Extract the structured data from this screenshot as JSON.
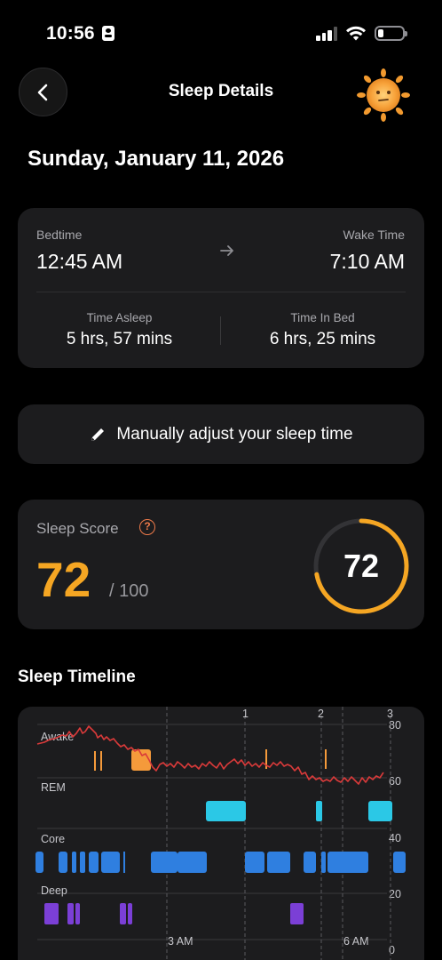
{
  "status_bar": {
    "time": "10:56"
  },
  "header": {
    "title": "Sleep Details"
  },
  "date_heading": "Sunday, January 11, 2026",
  "times": {
    "bedtime_label": "Bedtime",
    "bedtime": "12:45 AM",
    "wake_label": "Wake Time",
    "wake": "7:10 AM",
    "asleep_label": "Time Asleep",
    "asleep": "5 hrs, 57 mins",
    "in_bed_label": "Time In Bed",
    "in_bed": "6 hrs, 25 mins"
  },
  "adjust": {
    "label": "Manually adjust your sleep time"
  },
  "score": {
    "label": "Sleep Score",
    "value": "72",
    "max": "/ 100",
    "ring_value": "72",
    "fraction": 0.72,
    "color": "#f5a623"
  },
  "timeline": {
    "title": "Sleep Timeline",
    "stages": [
      "Awake",
      "REM",
      "Core",
      "Deep"
    ],
    "markers": [
      "1",
      "2",
      "3"
    ],
    "right_axis": [
      "80",
      "60",
      "40",
      "20",
      "0"
    ],
    "x_labels": [
      "3 AM",
      "6 AM"
    ],
    "colors": {
      "awake": "#f59a3b",
      "rem": "#2bc8e6",
      "core": "#2f7fe0",
      "deep": "#7b3fd6",
      "heart": "#d93a3a"
    }
  },
  "icons": {
    "back": "chevron-left-icon",
    "mascot": "sun-face-icon",
    "arrow": "arrow-right-icon",
    "pencil": "pencil-icon",
    "help": "question-circle-icon"
  }
}
